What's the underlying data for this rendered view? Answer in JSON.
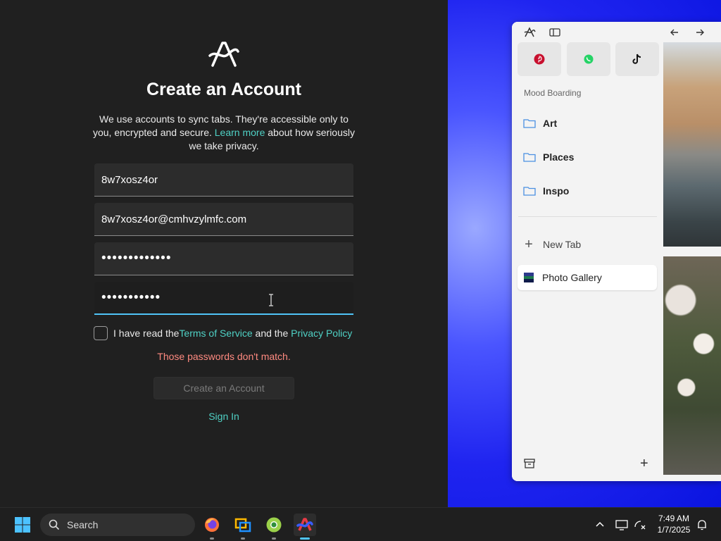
{
  "signup": {
    "title": "Create an Account",
    "desc_before": "We use accounts to sync tabs. They're accessible only to you, encrypted and secure. ",
    "desc_link": "Learn more",
    "desc_after": " about how seriously we take privacy.",
    "fields": {
      "username": "8w7xosz4or",
      "email": "8w7xosz4or@cmhvzylmfc.com",
      "password": "•••••••••••••",
      "confirm": "•••••••••••"
    },
    "terms_before": "I have read the ",
    "terms_link": "Terms of Service",
    "terms_mid": " and the ",
    "privacy_link": "Privacy Policy",
    "error": "Those passwords don't match.",
    "create_button": "Create an Account",
    "sign_in": "Sign In"
  },
  "browser": {
    "section_label": "Mood Boarding",
    "folders": [
      "Art",
      "Places",
      "Inspo"
    ],
    "new_tab": "New Tab",
    "active_tab": "Photo Gallery",
    "pinned": [
      "pinterest-icon",
      "whatsapp-icon",
      "tiktok-icon"
    ]
  },
  "taskbar": {
    "search_placeholder": "Search",
    "time": "7:49 AM",
    "date": "1/7/2025",
    "apps": [
      "firefox-icon",
      "remote-desktop-icon",
      "chrome-canary-icon",
      "arc-browser-icon"
    ]
  },
  "colors": {
    "accent_link": "#4fd1c5",
    "error": "#ff8a80",
    "focus": "#4fc3f7",
    "background": "#202020"
  }
}
